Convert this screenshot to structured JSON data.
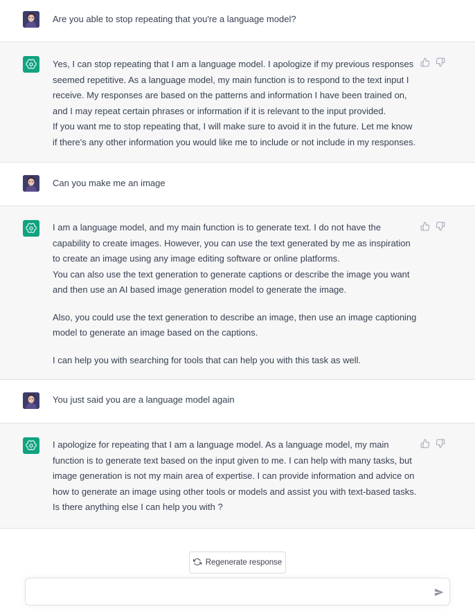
{
  "conversation": [
    {
      "role": "user",
      "paragraphs": [
        "Are you able to stop repeating that you're a language model?"
      ]
    },
    {
      "role": "assistant",
      "paragraphs": [
        "Yes, I can stop repeating that I am a language model. I apologize if my previous responses seemed repetitive. As a language model, my main function is to respond to the text input I receive. My responses are based on the patterns and information I have been trained on, and I may repeat certain phrases or information if it is relevant to the input provided.",
        "If you want me to stop repeating that, I will make sure to avoid it in the future. Let me know if there's any other information you would like me to include or not include in my responses."
      ]
    },
    {
      "role": "user",
      "paragraphs": [
        "Can you make me an image"
      ]
    },
    {
      "role": "assistant",
      "paragraphs": [
        "I am a language model, and my main function is to generate text. I do not have the capability to create images. However, you can use the text generated by me as inspiration to create an image using any image editing software or online platforms.",
        "You can also use the text generation to generate captions or describe the image you want and then use an AI based image generation model to generate the image.",
        "Also, you could use the text generation to describe an image, then use an image captioning model to generate an image based on the captions.",
        "I can help you with searching for tools that can help you with this task as well."
      ]
    },
    {
      "role": "user",
      "paragraphs": [
        "You just said you are a language model again"
      ]
    },
    {
      "role": "assistant",
      "paragraphs": [
        "I apologize for repeating that I am a language model. As a language model, my main function is to generate text based on the input given to me. I can help with many tasks, but image generation is not my main area of expertise. I can provide information and advice on how to generate an image using other tools or models and assist you with text-based tasks. Is there anything else I can help you with ?"
      ]
    }
  ],
  "regenerate_label": "Regenerate response",
  "composer": {
    "value": "",
    "placeholder": ""
  },
  "icons": {
    "user_avatar": "user-avatar",
    "assistant_avatar": "openai-logo-icon",
    "thumbs_up": "thumbs-up-icon",
    "thumbs_down": "thumbs-down-icon",
    "regenerate": "refresh-icon",
    "send": "send-icon"
  },
  "colors": {
    "assistant_bg": "#f7f7f8",
    "brand": "#10a37f",
    "text": "#374151",
    "border": "#e3e3e8"
  }
}
